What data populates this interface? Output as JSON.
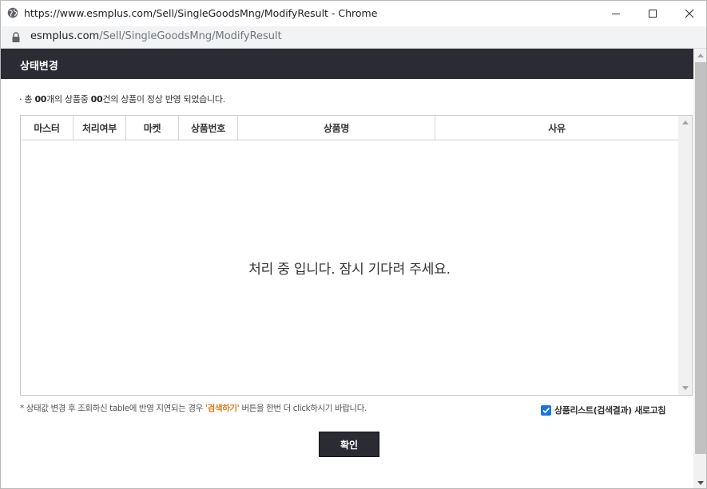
{
  "window": {
    "title": "https://www.esmplus.com/Sell/SingleGoodsMng/ModifyResult - Chrome",
    "url_host": "esmplus.com",
    "url_path": "/Sell/SingleGoodsMng/ModifyResult"
  },
  "popup": {
    "title": "상태변경"
  },
  "summary": {
    "bullet": "·",
    "prefix": "총 ",
    "total": "00",
    "middle": "개의 상품중 ",
    "count": "00",
    "suffix": "건의 상품이 정상 반영 되었습니다."
  },
  "table": {
    "columns": [
      "마스터",
      "처리여부",
      "마켓",
      "상품번호",
      "상품명",
      "사유"
    ],
    "rows": [],
    "loading_text": "처리 중 입니다. 잠시 기다려 주세요."
  },
  "note": {
    "before": "* 상태값 변경 후 조회하신 table에 반영 지연되는 경우 ",
    "highlight": "'검색하기'",
    "after": " 버튼을 한번 더 click하시기 바랍니다."
  },
  "refresh_option": {
    "label": "상품리스트(검색결과) 새로고침",
    "checked": true
  },
  "confirm_button": {
    "label": "확인"
  },
  "colors": {
    "header_bg": "#2a2b33",
    "highlight": "#e07a1c",
    "checkbox": "#1a73e8"
  },
  "icons": {
    "site": "globe-icon",
    "lock": "lock-icon",
    "minimize": "minimize-icon",
    "maximize": "maximize-icon",
    "close": "close-icon"
  }
}
